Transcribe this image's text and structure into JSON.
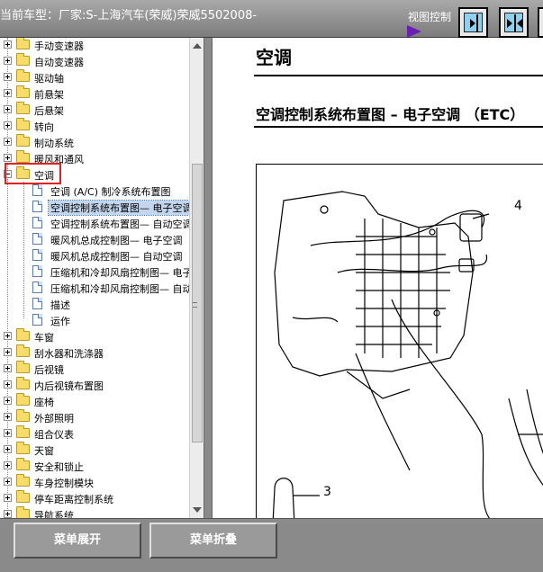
{
  "header": {
    "title": "当前车型：厂家:S-上海汽车(荣威)荣威5502008-",
    "view_control_label": "视图控制",
    "view_buttons": [
      {
        "name": "expand-right",
        "icon": "panel-right-arrow-icon"
      },
      {
        "name": "split",
        "icon": "panel-split-arrows-icon"
      },
      {
        "name": "more",
        "icon": "panel-left-icon"
      }
    ]
  },
  "tree": {
    "categories": [
      {
        "label": "手动变速器"
      },
      {
        "label": "自动变速器"
      },
      {
        "label": "驱动轴"
      },
      {
        "label": "前悬架"
      },
      {
        "label": "后悬架"
      },
      {
        "label": "转向"
      },
      {
        "label": "制动系统"
      },
      {
        "label": "暖风和通风"
      },
      {
        "label": "空调",
        "expanded": true,
        "highlighted": true
      },
      {
        "label": "车窗"
      },
      {
        "label": "刮水器和洗涤器"
      },
      {
        "label": "后视镜"
      },
      {
        "label": "内后视镜布置图"
      },
      {
        "label": "座椅"
      },
      {
        "label": "外部照明"
      },
      {
        "label": "组合仪表"
      },
      {
        "label": "天窗"
      },
      {
        "label": "安全和锁止"
      },
      {
        "label": "车身控制模块"
      },
      {
        "label": "停车距离控制系统"
      },
      {
        "label": "导航系统"
      }
    ],
    "children": [
      {
        "label": "空调 (A/C) 制冷系统布置图"
      },
      {
        "label": "空调控制系统布置图— 电子空调",
        "selected": true
      },
      {
        "label": "空调控制系统布置图— 自动空调"
      },
      {
        "label": "暖风机总成控制图— 电子空调"
      },
      {
        "label": "暖风机总成控制图— 自动空调"
      },
      {
        "label": "压缩机和冷却风扇控制图— 电子空调"
      },
      {
        "label": "压缩机和冷却风扇控制图— 自动空调"
      },
      {
        "label": "描述"
      },
      {
        "label": "运作"
      }
    ]
  },
  "document": {
    "page_title": "空调",
    "section_title": "空调控制系统布置图 – 电子空调 （ETC）",
    "callouts": [
      "4",
      "3"
    ]
  },
  "footer": {
    "expand_label": "菜单展开",
    "collapse_label": "菜单折叠"
  },
  "colors": {
    "highlight_box": "#e32020",
    "view_arrow": "#6a1fb3",
    "button_face": "#8fd0ef"
  }
}
